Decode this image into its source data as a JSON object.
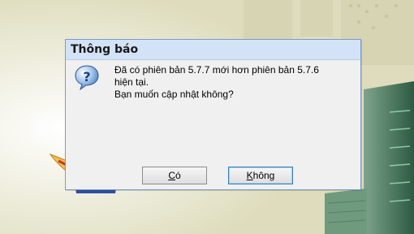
{
  "dialog": {
    "title": "Thông báo",
    "message_line1": "Đã có phiên bản 5.7.7 mới hơn phiên bản 5.7.6",
    "message_line2": "hiện tại.",
    "message_line3": "Bạn muốn cập nhật không?",
    "icon": "question-icon",
    "yes_label": "Có",
    "yes_label_rest": "ó",
    "yes_mnemonic": "C",
    "no_label": "Không",
    "no_mnemonic": "K",
    "no_label_rest": "hông"
  },
  "colors": {
    "titlebar": "#d3e3f7",
    "dialog_bg": "#f0f0f0",
    "desktop": "#dcdcbe",
    "building": "#3e6b52"
  }
}
